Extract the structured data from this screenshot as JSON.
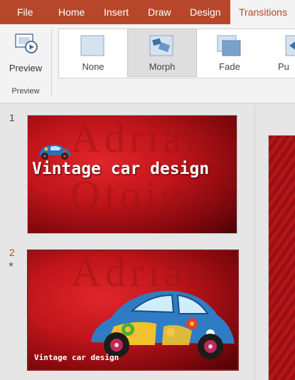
{
  "ribbon": {
    "tabs": [
      {
        "label": "File"
      },
      {
        "label": "Home"
      },
      {
        "label": "Insert"
      },
      {
        "label": "Draw"
      },
      {
        "label": "Design"
      },
      {
        "label": "Transitions",
        "active": true
      }
    ],
    "preview_label": "Preview",
    "preview_group_label": "Preview",
    "gallery": [
      {
        "label": "None",
        "icon": "none-transition-icon"
      },
      {
        "label": "Morph",
        "icon": "morph-transition-icon",
        "selected": true
      },
      {
        "label": "Fade",
        "icon": "fade-transition-icon"
      },
      {
        "label": "Pu",
        "icon": "push-transition-icon"
      }
    ]
  },
  "slides": [
    {
      "number": "1",
      "title": "Vintage car design",
      "background_text": [
        "Adrian",
        "Otoiu"
      ]
    },
    {
      "number": "2",
      "title": "Vintage car design",
      "background_text": [
        "Adrian"
      ],
      "active": true
    }
  ],
  "colors": {
    "accent": "#b7472a",
    "slide_red": "#c0151b"
  }
}
